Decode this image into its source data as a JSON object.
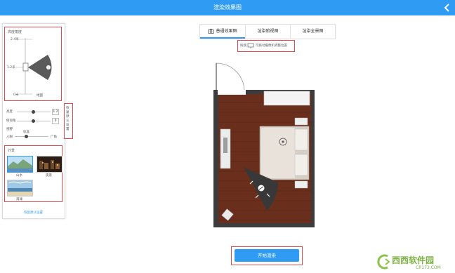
{
  "header": {
    "title": "渲染效果图",
    "back_icon": "chevron-left-icon"
  },
  "left_panel": {
    "height_section": {
      "title": "高度角度",
      "top_value": "2.4米",
      "middle_value": "1.2米",
      "bottom_value": "0米",
      "floor_label": "地面"
    },
    "height_slider": {
      "label": "高度",
      "value": "1.2",
      "level": 0.5
    },
    "pitch_slider": {
      "label": "俯仰角",
      "value": "0",
      "level": 0.5
    },
    "fov": {
      "label": "视野",
      "mid_label": "标准",
      "left_label": "人眼",
      "right_label": "广角",
      "level": 0.3
    },
    "reset_label": "恢复默认设置",
    "exterior": {
      "title": "外景",
      "items": [
        {
          "label": "山水",
          "selected": true
        },
        {
          "label": "夜景",
          "selected": false
        },
        {
          "label": "海滩",
          "selected": false
        }
      ]
    },
    "footer_link": "恢复默认设置"
  },
  "tabs": [
    {
      "label": "普通效果图",
      "icon": "camera-icon",
      "active": true
    },
    {
      "label": "渲染俯视图",
      "active": false
    },
    {
      "label": "渲染全景图",
      "active": false
    }
  ],
  "hint": {
    "prefix": "拖拽",
    "text": "可拖动摄像机调整位置"
  },
  "start_button": "开始渲染",
  "watermark": {
    "main": "西西软件园",
    "sub": "CR173.COM"
  },
  "colors": {
    "accent": "#2f9bf3",
    "highlight": "#e14a4a"
  }
}
